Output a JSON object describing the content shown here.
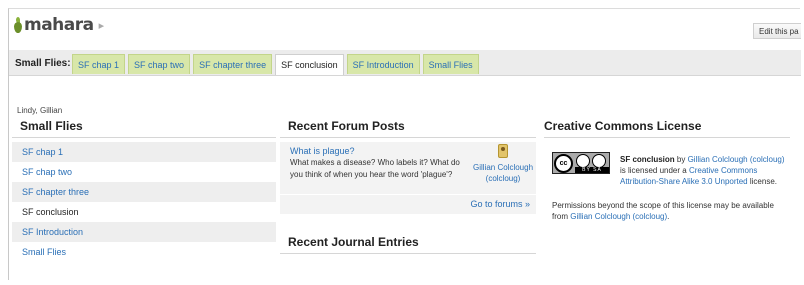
{
  "header": {
    "logo_text": "mahara",
    "logo_chevron": "▸",
    "edit_button_label": "Edit this pa"
  },
  "tabbar": {
    "label": "Small Flies:",
    "tabs": [
      {
        "label": "SF chap 1",
        "active": false
      },
      {
        "label": "SF chap two",
        "active": false
      },
      {
        "label": "SF chapter three",
        "active": false
      },
      {
        "label": "SF conclusion",
        "active": true
      },
      {
        "label": "SF Introduction",
        "active": false
      },
      {
        "label": "Small Flies",
        "active": false
      }
    ]
  },
  "owner": "Lindy, Gillian",
  "nav_block": {
    "title": "Small Flies",
    "items": [
      {
        "label": "SF chap 1",
        "current": false
      },
      {
        "label": "SF chap two",
        "current": false
      },
      {
        "label": "SF chapter three",
        "current": false
      },
      {
        "label": "SF conclusion",
        "current": true
      },
      {
        "label": "SF Introduction",
        "current": false
      },
      {
        "label": "Small Flies",
        "current": false
      }
    ]
  },
  "forum_block": {
    "title": "Recent Forum Posts",
    "topic": "What is plague?",
    "body": "What makes a disease? Who labels it? What do you think of when you hear the word 'plague'?",
    "author": "Gillian Colclough (colcloug)",
    "more_link": "Go to forums »"
  },
  "journal_block": {
    "title": "Recent Journal Entries"
  },
  "license_block": {
    "title": "Creative Commons License",
    "badge_cc": "cc",
    "badge_strip": "BY    SA",
    "work_title": "SF conclusion",
    "by_text": " by ",
    "author": "Gillian Colclough (colcloug)",
    "licensed_text": " is licensed under a ",
    "license_name": "Creative Commons Attribution-Share Alike 3.0 Unported",
    "license_suffix": " license.",
    "permissions_text": "Permissions beyond the scope of this license may be available from ",
    "permissions_link": "Gillian Colclough (colcloug)",
    "permissions_end": "."
  },
  "colors": {
    "link": "#2a6fb6",
    "tab_bg": "#d8e7a9",
    "logo_green": "#6b8f2a"
  }
}
